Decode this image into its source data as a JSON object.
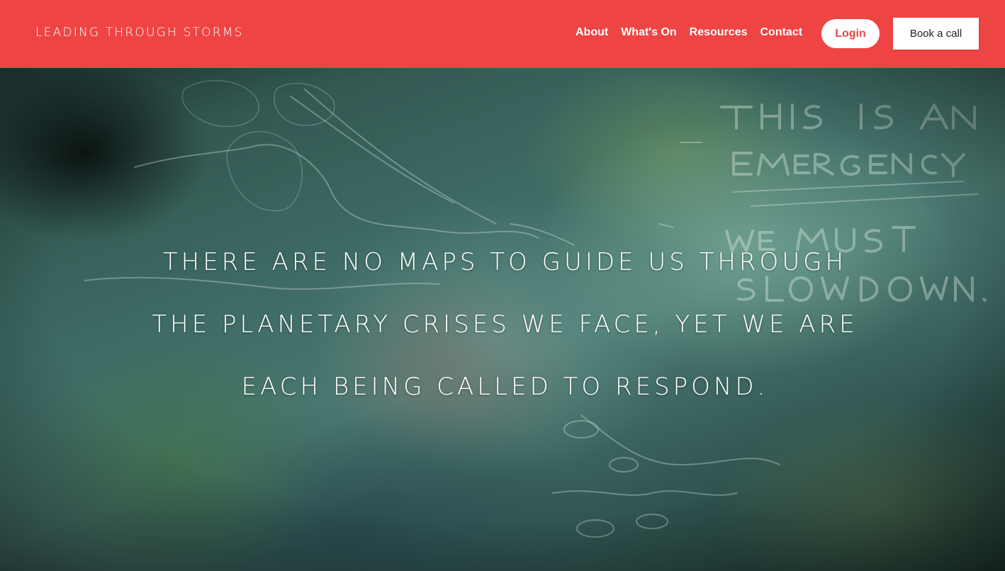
{
  "header": {
    "logo": "LEADING THROUGH STORMS",
    "nav": [
      "About",
      "What's On",
      "Resources",
      "Contact"
    ],
    "login_label": "Login",
    "book_label": "Book a call",
    "background_color": "#ef4444"
  },
  "hero": {
    "headline": "There are no maps to guide us through the planetary crises we face, yet we are each being called to respond.",
    "background_sketch_text": [
      "THIS IS AN",
      "EMERGENCY",
      "WE MUST",
      "SLOW DOWN."
    ]
  }
}
